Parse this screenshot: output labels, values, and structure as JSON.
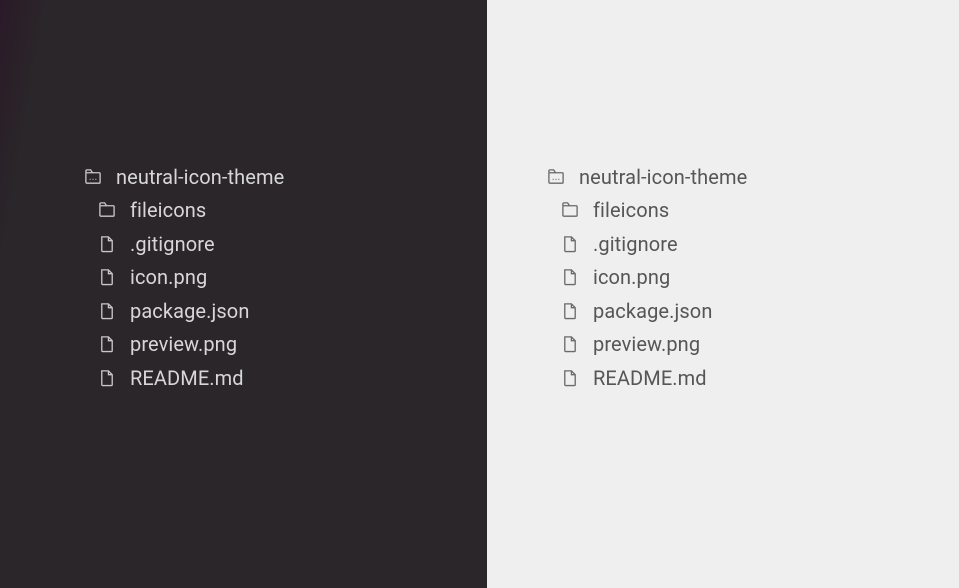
{
  "panes": {
    "dark": {
      "root": {
        "label": "neutral-icon-theme",
        "icon": "root-folder"
      },
      "children": [
        {
          "label": "fileicons",
          "icon": "folder"
        },
        {
          "label": ".gitignore",
          "icon": "file"
        },
        {
          "label": "icon.png",
          "icon": "file"
        },
        {
          "label": "package.json",
          "icon": "file"
        },
        {
          "label": "preview.png",
          "icon": "file"
        },
        {
          "label": "README.md",
          "icon": "file"
        }
      ]
    },
    "light": {
      "root": {
        "label": "neutral-icon-theme",
        "icon": "root-folder"
      },
      "children": [
        {
          "label": "fileicons",
          "icon": "folder"
        },
        {
          "label": ".gitignore",
          "icon": "file"
        },
        {
          "label": "icon.png",
          "icon": "file"
        },
        {
          "label": "package.json",
          "icon": "file"
        },
        {
          "label": "preview.png",
          "icon": "file"
        },
        {
          "label": "README.md",
          "icon": "file"
        }
      ]
    }
  }
}
